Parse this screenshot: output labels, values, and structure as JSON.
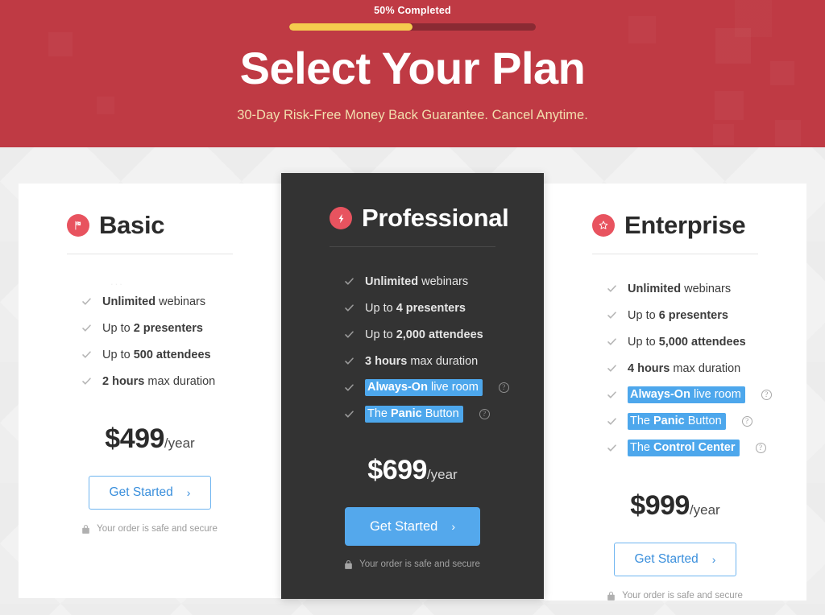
{
  "header": {
    "progress_label": "50% Completed",
    "progress_percent": 50,
    "title": "Select Your Plan",
    "subtitle": "30-Day Risk-Free Money Back Guarantee. Cancel Anytime.",
    "bg_color": "#bf3a44",
    "progress_fill_color": "#f5cb4e",
    "progress_track_color": "#8a2a33",
    "subtitle_color": "#f2dfae"
  },
  "common": {
    "cta_label": "Get Started",
    "cta_chevron": "›",
    "secure_text": "Your order is safe and secure",
    "lock_icon": "lock-icon",
    "check_icon": "check-icon",
    "help_icon": "help-circle-icon",
    "help_glyph": "?",
    "price_period": "/year",
    "selection_color": "#4da7ec",
    "accent_color": "#e8535f",
    "link_color": "#3a8fdc"
  },
  "plans": [
    {
      "id": "basic",
      "name": "Basic",
      "icon": "flag-icon",
      "featured": false,
      "placeholder": "...",
      "features": [
        {
          "bold": "Unlimited",
          "rest": " webinars",
          "lead": "",
          "selected": false,
          "help": false
        },
        {
          "lead": "Up to ",
          "bold": "2 presenters",
          "rest": "",
          "selected": false,
          "help": false
        },
        {
          "lead": "Up to ",
          "bold": "500 attendees",
          "rest": "",
          "selected": false,
          "help": false
        },
        {
          "lead": "",
          "bold": "2 hours",
          "rest": " max duration",
          "selected": false,
          "help": false
        }
      ],
      "price": "$499"
    },
    {
      "id": "professional",
      "name": "Professional",
      "icon": "lightning-bolt-icon",
      "featured": true,
      "features": [
        {
          "lead": "",
          "bold": "Unlimited",
          "rest": " webinars",
          "selected": false,
          "help": false
        },
        {
          "lead": "Up to ",
          "bold": "4 presenters",
          "rest": "",
          "selected": false,
          "help": false
        },
        {
          "lead": "Up to ",
          "bold": "2,000 attendees",
          "rest": "",
          "selected": false,
          "help": false
        },
        {
          "lead": "",
          "bold": "3 hours",
          "rest": " max duration",
          "selected": false,
          "help": false
        },
        {
          "lead": "",
          "bold": "Always-On",
          "rest": " live room",
          "selected": true,
          "help": true
        },
        {
          "lead": "The ",
          "bold": "Panic",
          "rest": " Button",
          "selected": true,
          "help": true
        }
      ],
      "price": "$699"
    },
    {
      "id": "enterprise",
      "name": "Enterprise",
      "icon": "star-icon",
      "featured": false,
      "features": [
        {
          "lead": "",
          "bold": "Unlimited",
          "rest": " webinars",
          "selected": false,
          "help": false
        },
        {
          "lead": "Up to ",
          "bold": "6 presenters",
          "rest": "",
          "selected": false,
          "help": false
        },
        {
          "lead": "Up to ",
          "bold": "5,000 attendees",
          "rest": "",
          "selected": false,
          "help": false
        },
        {
          "lead": "",
          "bold": "4 hours",
          "rest": " max duration",
          "selected": false,
          "help": false
        },
        {
          "lead": "",
          "bold": "Always-On",
          "rest": " live room",
          "selected": true,
          "help": true
        },
        {
          "lead": "The ",
          "bold": "Panic",
          "rest": " Button",
          "selected": true,
          "help": true
        },
        {
          "lead": "The ",
          "bold": "Control Center",
          "rest": "",
          "selected": true,
          "help": true
        }
      ],
      "price": "$999"
    }
  ]
}
